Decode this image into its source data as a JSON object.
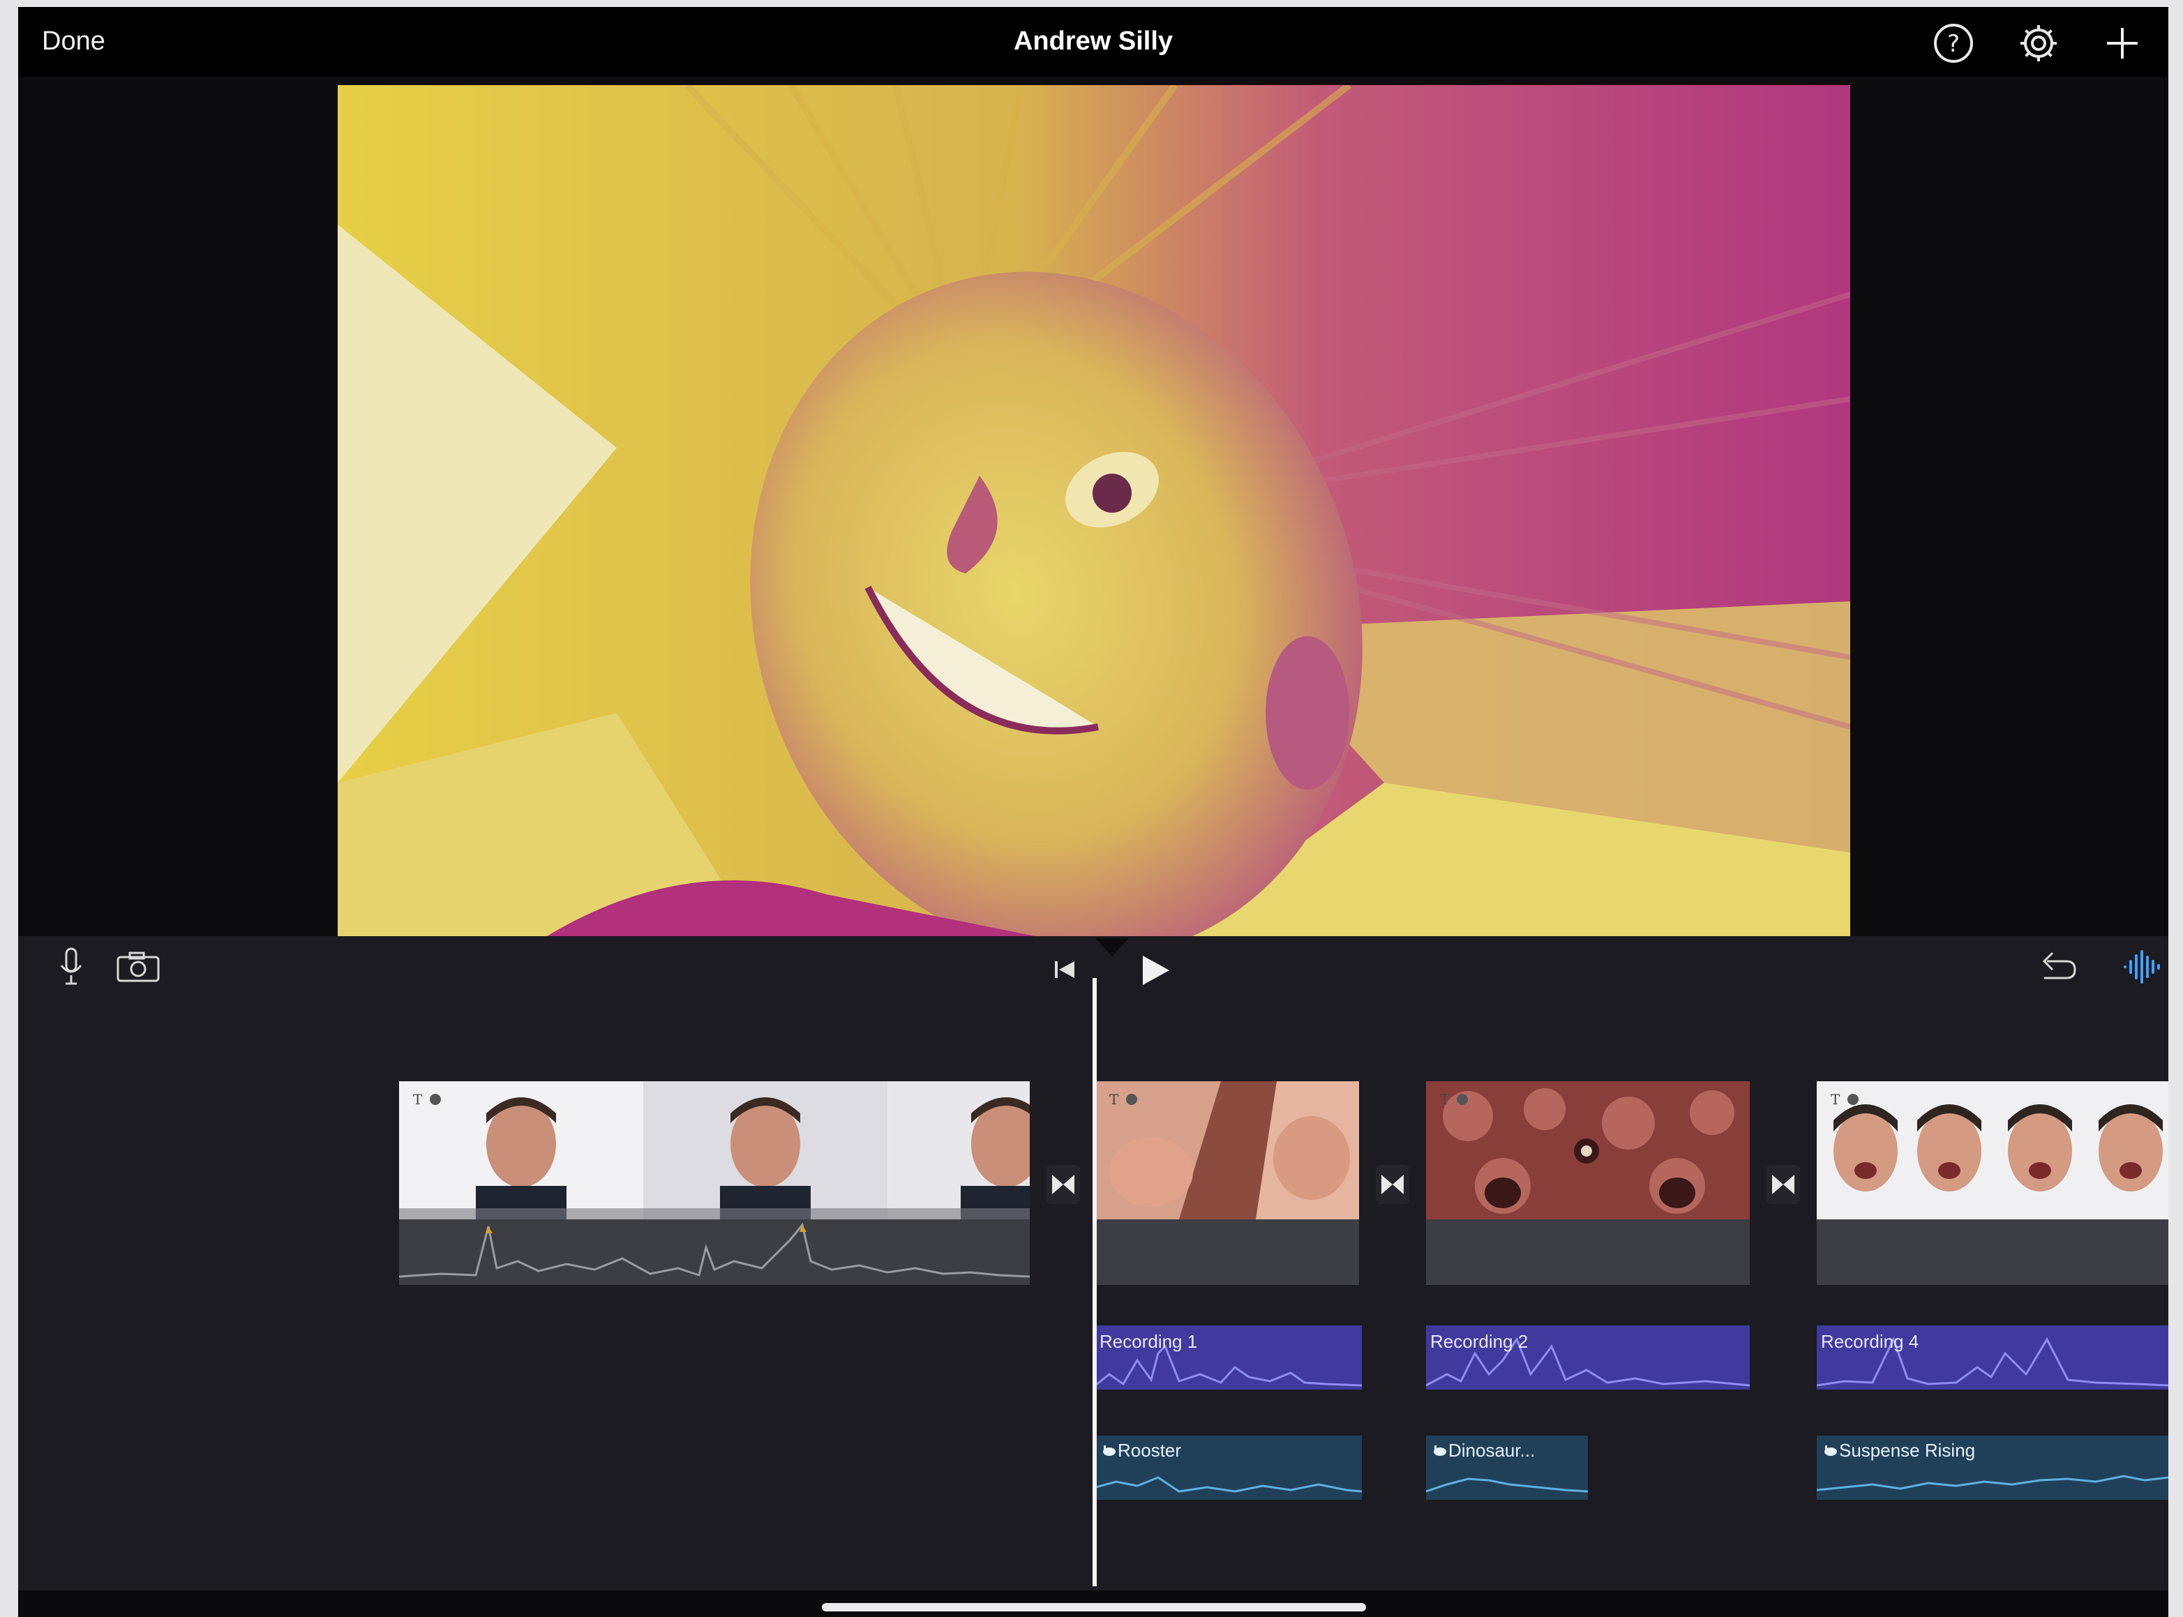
{
  "topbar": {
    "done_label": "Done",
    "project_title": "Andrew Silly",
    "help_icon": "help-circle-icon",
    "settings_icon": "gear-icon",
    "add_icon": "plus-icon"
  },
  "controls": {
    "voiceover_icon": "microphone-icon",
    "camera_icon": "camera-icon",
    "rewind_icon": "skip-to-start-icon",
    "play_icon": "play-icon",
    "undo_icon": "undo-icon",
    "audio_waveform_icon": "waveform-icon"
  },
  "timeline": {
    "video_clips": [
      {
        "id": "clip-1",
        "badges": [
          "T",
          "filter"
        ]
      },
      {
        "id": "clip-2",
        "badges": [
          "T",
          "filter"
        ]
      },
      {
        "id": "clip-3",
        "badges": [
          "T",
          "filter"
        ]
      },
      {
        "id": "clip-4",
        "badges": [
          "T",
          "filter"
        ]
      }
    ],
    "recordings": [
      {
        "label": "Recording 1"
      },
      {
        "label": "Recording 2"
      },
      {
        "label": "Recording 4"
      }
    ],
    "sound_effects": [
      {
        "label": "Rooster"
      },
      {
        "label": "Dinosaur..."
      },
      {
        "label": "Suspense Rising"
      }
    ]
  },
  "colors": {
    "accent_blue": "#3fa0ff",
    "recording_purple": "#403a9e",
    "sfx_teal": "#20405a",
    "preview_yellow": "#e7d24a",
    "preview_magenta": "#b0377e"
  }
}
